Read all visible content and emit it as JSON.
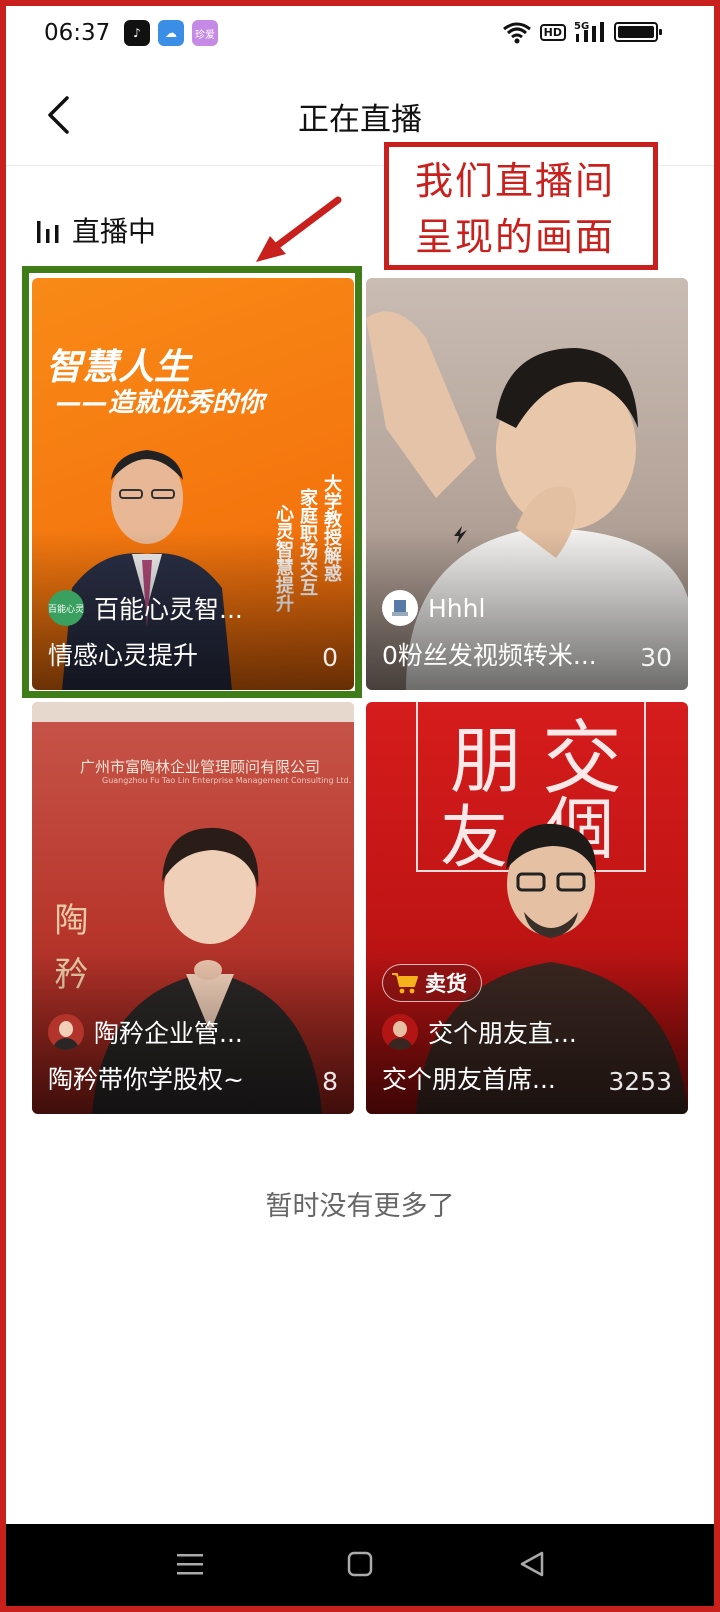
{
  "status_bar": {
    "time": "06:37",
    "app_icons": [
      "tiktok-icon",
      "weather-icon",
      "zhenai-icon"
    ],
    "zhenai_icon_text": "珍爱",
    "hd_label": "HD",
    "network_label": "5G"
  },
  "header": {
    "title": "正在直播"
  },
  "annotation": {
    "line1": "我们直播间",
    "line2": "呈现的画面",
    "color": "#c8201c",
    "highlight_color": "#3f7d18"
  },
  "section": {
    "title": "直播中"
  },
  "streams": [
    {
      "host": "百能心灵智...",
      "title": "情感心灵提升",
      "viewers": "0",
      "cover_text_main": "智慧人生",
      "cover_text_sub": "——造就优秀的你",
      "cover_vertical_1": "大学教授解惑",
      "cover_vertical_2": "家庭职场交互",
      "cover_vertical_3": "心灵智慧提升",
      "avatar_text": "百能心灵",
      "highlighted": true
    },
    {
      "host": "Hhhl",
      "title": "0粉丝发视频转米...",
      "viewers": "30",
      "highlighted": false
    },
    {
      "host": "陶矜企业管...",
      "title": "陶矜带你学股权~",
      "viewers": "8",
      "cover_company": "广州市富陶林企业管理顾问有限公司",
      "cover_company_en": "Guangzhou Fu Tao Lin Enterprise Management Consulting Ltd.",
      "cover_vertical": "陶矜",
      "highlighted": false
    },
    {
      "host": "交个朋友直...",
      "title": "交个朋友首席...",
      "viewers": "3253",
      "badge": "卖货",
      "cover_logo_1": "交",
      "cover_logo_2": "朋",
      "cover_logo_3": "友",
      "cover_logo_4": "個",
      "highlighted": false
    }
  ],
  "footer": {
    "end_text": "暂时没有更多了"
  },
  "navbar": {
    "buttons": [
      "menu-icon",
      "home-icon",
      "back-icon"
    ]
  }
}
